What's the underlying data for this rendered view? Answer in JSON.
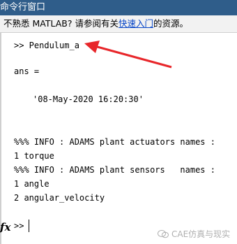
{
  "window": {
    "title": "命令行窗口"
  },
  "info_bar": {
    "prefix": "不熟悉 MATLAB? 请参阅有关",
    "link": "快速入门",
    "suffix": "的资源。"
  },
  "console": {
    "lines": [
      ">> Pendulum_a",
      "ans =",
      "'08-May-2020 16:20:30'",
      "%%% INFO : ADAMS plant actuators names :",
      "1 torque",
      "%%% INFO : ADAMS plant sensors   names :",
      "1 angle",
      "2 angular_velocity"
    ],
    "prompt": ">>",
    "fx_label": "fx"
  },
  "annotation": {
    "arrow_color": "#e8262a",
    "icon": "red-arrow-icon"
  },
  "watermark": {
    "text": "CAE仿真与现实",
    "icon": "wechat-icon"
  }
}
